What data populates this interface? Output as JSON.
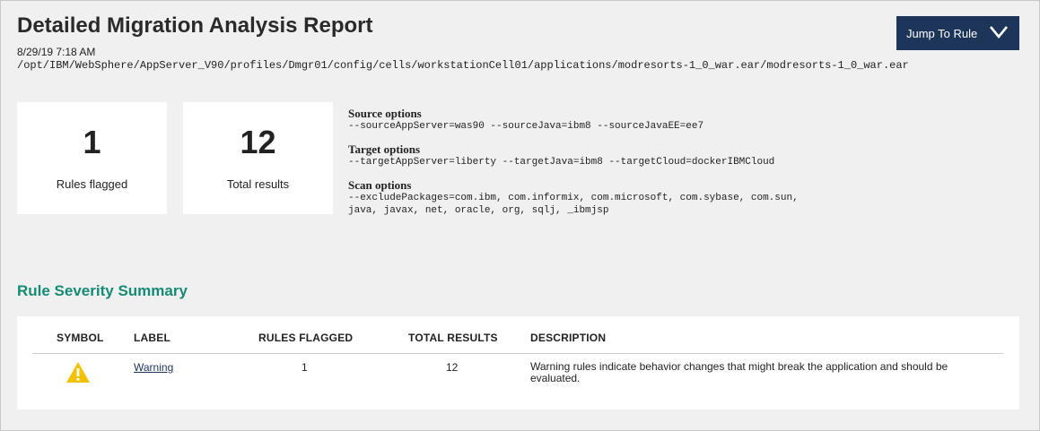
{
  "header": {
    "title": "Detailed Migration Analysis Report",
    "timestamp": "8/29/19 7:18 AM",
    "path": "/opt/IBM/WebSphere/AppServer_V90/profiles/Dmgr01/config/cells/workstationCell01/applications/modresorts-1_0_war.ear/modresorts-1_0_war.ear",
    "jump_label": "Jump To Rule",
    "jump_icon": "chevron-down-icon"
  },
  "stats": [
    {
      "value": "1",
      "label": "Rules flagged"
    },
    {
      "value": "12",
      "label": "Total results"
    }
  ],
  "options": [
    {
      "title": "Source options",
      "value": "--sourceAppServer=was90 --sourceJava=ibm8 --sourceJavaEE=ee7"
    },
    {
      "title": "Target options",
      "value": "--targetAppServer=liberty --targetJava=ibm8 --targetCloud=dockerIBMCloud"
    },
    {
      "title": "Scan options",
      "value": "--excludePackages=com.ibm, com.informix, com.microsoft, com.sybase, com.sun,\njava, javax, net, oracle, org, sqlj, _ibmjsp"
    }
  ],
  "summary": {
    "title": "Rule Severity Summary",
    "columns": [
      "SYMBOL",
      "LABEL",
      "RULES FLAGGED",
      "TOTAL RESULTS",
      "DESCRIPTION"
    ],
    "rows": [
      {
        "symbol": "warning-icon",
        "label": "Warning",
        "rules_flagged": "1",
        "total_results": "12",
        "description": "Warning rules indicate behavior changes that might break the application and should be evaluated."
      }
    ]
  },
  "colors": {
    "accent": "#168a74",
    "button": "#1d3558",
    "warning": "#f2c200"
  }
}
